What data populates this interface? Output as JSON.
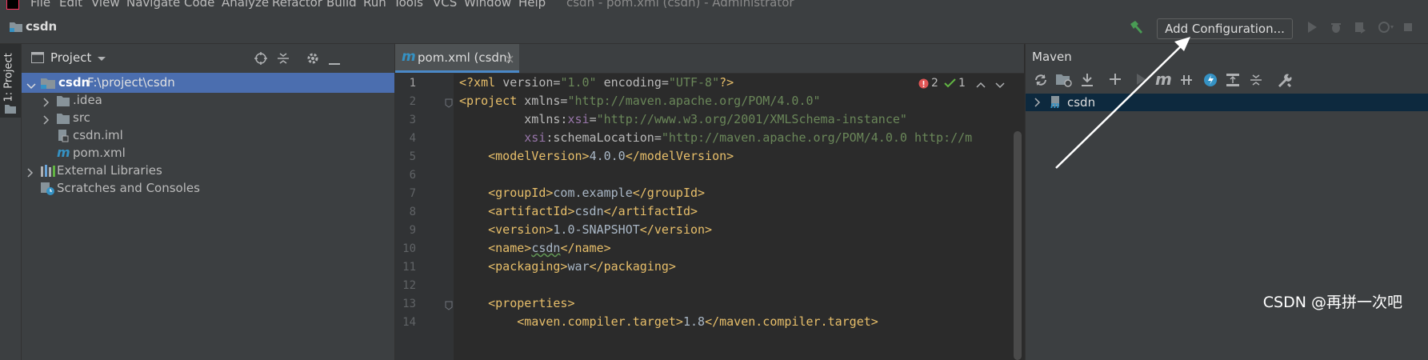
{
  "menu": {
    "items": [
      "File",
      "Edit",
      "View",
      "Navigate",
      "Code",
      "Analyze",
      "Refactor",
      "Build",
      "Run",
      "Tools",
      "VCS",
      "Window",
      "Help"
    ],
    "window_title": "csdn - pom.xml (csdn) - Administrator"
  },
  "nav": {
    "project_name": "csdn",
    "add_configuration_label": "Add Configuration..."
  },
  "side_strip": {
    "project_tab_label": "1: Project"
  },
  "project": {
    "title": "Project",
    "root": {
      "name": "csdn",
      "path": "F:\\project\\csdn"
    },
    "children": [
      ".idea",
      "src",
      "csdn.iml",
      "pom.xml"
    ],
    "external_libraries": "External Libraries",
    "scratches": "Scratches and Consoles"
  },
  "editor": {
    "tab_label": "pom.xml (csdn)",
    "inspections": {
      "errors": "2",
      "ok": "1"
    },
    "line_numbers": [
      "1",
      "2",
      "3",
      "4",
      "5",
      "6",
      "7",
      "8",
      "9",
      "10",
      "11",
      "12",
      "13",
      "14"
    ]
  },
  "maven": {
    "title": "Maven",
    "tree_root": "csdn"
  },
  "watermark": "CSDN @再拼一次吧",
  "colors": {
    "background": "#2b2b2b",
    "panel": "#3c3f41",
    "selection": "#4b6eaf",
    "xml_tag": "#e8bf6a",
    "xml_string": "#6a8759",
    "xml_namespace": "#9876aa",
    "error": "#e05555",
    "ok": "#62b543"
  }
}
